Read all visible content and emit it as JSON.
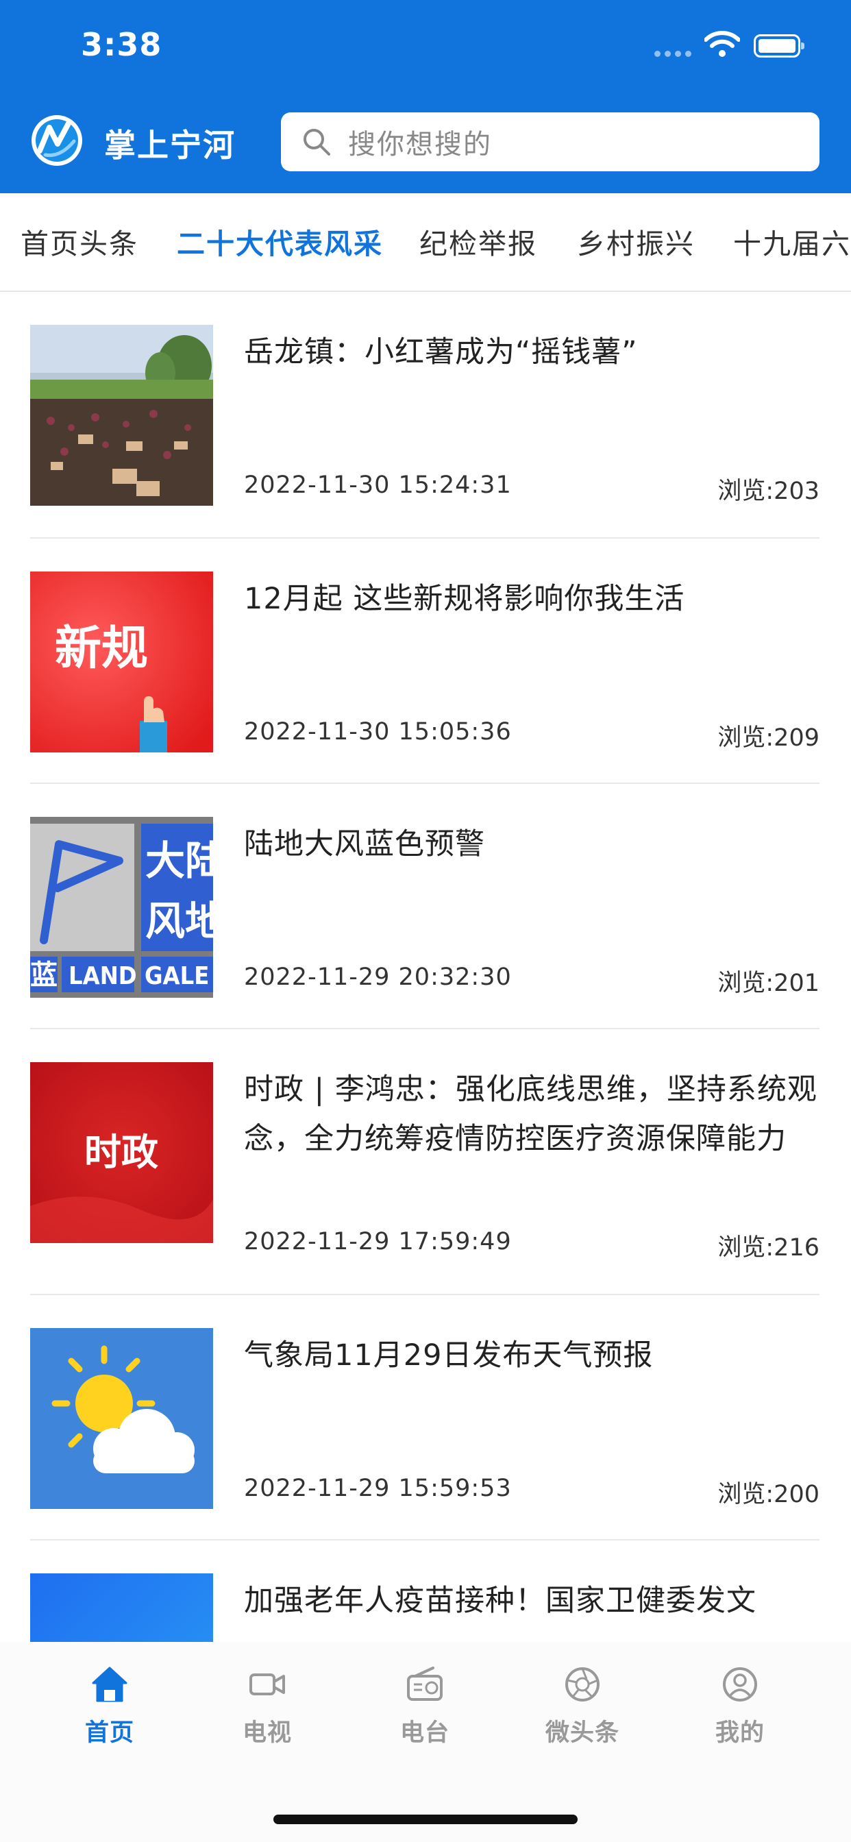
{
  "status_bar": {
    "time": "3:38"
  },
  "header": {
    "app_title": "掌上宁河",
    "search_placeholder": "搜你想搜的",
    "brand_color": "#1174dd"
  },
  "tabs": [
    {
      "label": "首页头条",
      "active": false
    },
    {
      "label": "二十大代表风采",
      "active": true
    },
    {
      "label": "纪检举报",
      "active": false
    },
    {
      "label": "乡村振兴",
      "active": false
    },
    {
      "label": "十九届六",
      "active": false
    }
  ],
  "news": [
    {
      "title": "岳龙镇：小红薯成为“摇钱薯”",
      "date": "2022-11-30 15:24:31",
      "views": "浏览:203",
      "thumb": "sweet-potato-field-photo"
    },
    {
      "title": "12月起 这些新规将影响你我生活",
      "date": "2022-11-30 15:05:36",
      "views": "浏览:209",
      "thumb_text": "新规"
    },
    {
      "title": "陆地大风蓝色预警",
      "date": "2022-11-29 20:32:30",
      "views": "浏览:201",
      "thumb_text_1": "大陆",
      "thumb_text_2": "风地",
      "thumb_text_3": "蓝",
      "thumb_text_4": "LAND GALE"
    },
    {
      "title": "时政 | 李鸿忠：强化底线思维，坚持系统观念，全力统筹疫情防控医疗资源保障能力",
      "date": "2022-11-29 17:59:49",
      "views": "浏览:216",
      "thumb_text": "时政"
    },
    {
      "title": "气象局11月29日发布天气预报",
      "date": "2022-11-29 15:59:53",
      "views": "浏览:200",
      "thumb": "sun-cloud-icon"
    },
    {
      "title": "加强老年人疫苗接种！国家卫健委发文"
    }
  ],
  "bottom_nav": [
    {
      "label": "首页",
      "icon": "home-icon",
      "active": true
    },
    {
      "label": "电视",
      "icon": "video-camera-icon",
      "active": false
    },
    {
      "label": "电台",
      "icon": "radio-icon",
      "active": false
    },
    {
      "label": "微头条",
      "icon": "aperture-icon",
      "active": false
    },
    {
      "label": "我的",
      "icon": "user-icon",
      "active": false
    }
  ]
}
